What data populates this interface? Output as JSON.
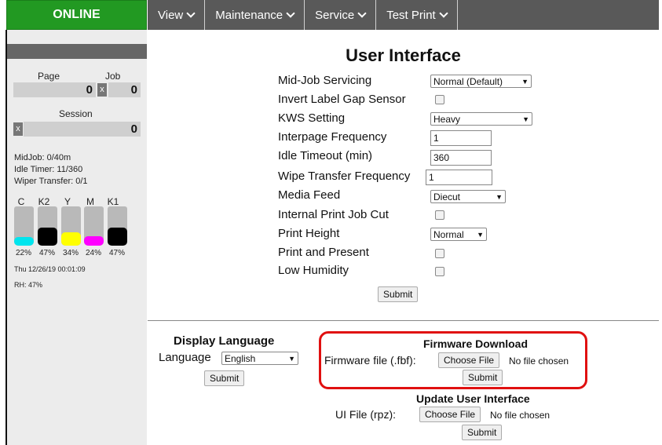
{
  "status": {
    "label": "ONLINE",
    "color": "#229922"
  },
  "nav": [
    {
      "label": "View"
    },
    {
      "label": "Maintenance"
    },
    {
      "label": "Service"
    },
    {
      "label": "Test Print"
    }
  ],
  "counters": {
    "page_label": "Page",
    "job_label": "Job",
    "page_value": "0",
    "job_value": "0",
    "session_label": "Session",
    "session_value": "0",
    "reset_glyph": "x"
  },
  "stats": {
    "midjob": "MidJob: 0/40m",
    "idle_timer": "Idle Timer: 11/360",
    "wiper_transfer": "Wiper Transfer: 0/1",
    "datetime": "Thu 12/26/19 00:01:09",
    "rh": "RH: 47%"
  },
  "inks": [
    {
      "letter": "C",
      "pct_label": "22%",
      "level": 0.22,
      "color": "#00e5ee"
    },
    {
      "letter": "K2",
      "pct_label": "47%",
      "level": 0.47,
      "color": "#000000"
    },
    {
      "letter": "Y",
      "pct_label": "34%",
      "level": 0.34,
      "color": "#ffff00"
    },
    {
      "letter": "M",
      "pct_label": "24%",
      "level": 0.24,
      "color": "#ff00ff"
    },
    {
      "letter": "K1",
      "pct_label": "47%",
      "level": 0.47,
      "color": "#000000"
    }
  ],
  "page": {
    "title": "User Interface",
    "fields": {
      "mid_job_servicing": {
        "label": "Mid-Job Servicing",
        "value": "Normal (Default)"
      },
      "invert_label_gap_sensor": {
        "label": "Invert Label Gap Sensor",
        "checked": false
      },
      "kws_setting": {
        "label": "KWS Setting",
        "value": "Heavy"
      },
      "interpage_frequency": {
        "label": "Interpage Frequency",
        "value": "1"
      },
      "idle_timeout": {
        "label": "Idle Timeout (min)",
        "value": "360"
      },
      "wipe_transfer_frequency": {
        "label": "Wipe Transfer Frequency",
        "value": "1"
      },
      "media_feed": {
        "label": "Media Feed",
        "value": "Diecut"
      },
      "internal_print_job_cut": {
        "label": "Internal Print Job Cut",
        "checked": false
      },
      "print_height": {
        "label": "Print Height",
        "value": "Normal"
      },
      "print_and_present": {
        "label": "Print and Present",
        "checked": false
      },
      "low_humidity": {
        "label": "Low Humidity",
        "checked": false
      }
    },
    "submit_label": "Submit"
  },
  "display_language": {
    "title": "Display Language",
    "label": "Language",
    "value": "English",
    "submit_label": "Submit"
  },
  "firmware_download": {
    "title": "Firmware Download",
    "label": "Firmware file (.fbf):",
    "choose_label": "Choose File",
    "no_file": "No file chosen",
    "submit_label": "Submit"
  },
  "update_ui": {
    "title": "Update User Interface",
    "label": "UI File (rpz):",
    "choose_label": "Choose File",
    "no_file": "No file chosen",
    "submit_label": "Submit"
  }
}
